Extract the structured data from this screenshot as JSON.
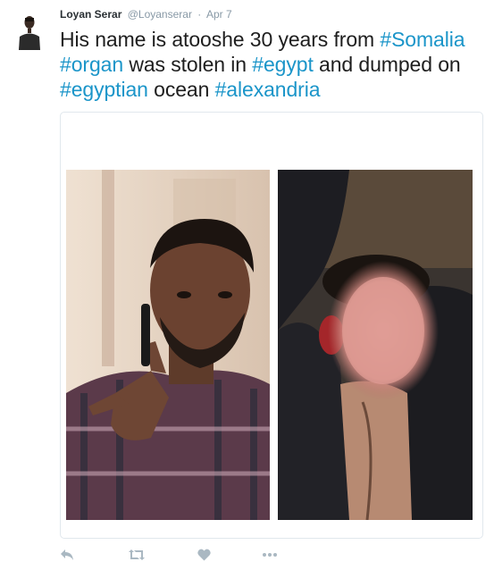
{
  "tweet": {
    "author_name": "Loyan Serar",
    "author_handle": "@Loyanserar",
    "separator": "·",
    "timestamp": "Apr 7",
    "text_segments": [
      {
        "text": "His name is atooshe 30 years from ",
        "hashtag": false
      },
      {
        "text": "#Somalia",
        "hashtag": true
      },
      {
        "text": " ",
        "hashtag": false
      },
      {
        "text": "#organ",
        "hashtag": true
      },
      {
        "text": " was stolen in ",
        "hashtag": false
      },
      {
        "text": "#egypt",
        "hashtag": true
      },
      {
        "text": " and dumped on ",
        "hashtag": false
      },
      {
        "text": "#egyptian",
        "hashtag": true
      },
      {
        "text": " ocean ",
        "hashtag": false
      },
      {
        "text": "#alexandria",
        "hashtag": true
      }
    ]
  },
  "media": {
    "left_photo": "portrait-photo",
    "right_photo": "blurred-face-photo"
  },
  "actions": {
    "reply_icon": "reply-icon",
    "retweet_icon": "retweet-icon",
    "like_icon": "heart-icon",
    "more_icon": "more-icon"
  },
  "colors": {
    "hashtag": "#1b95c9",
    "meta": "#8899a6",
    "action_icons": "#aab8c2"
  }
}
